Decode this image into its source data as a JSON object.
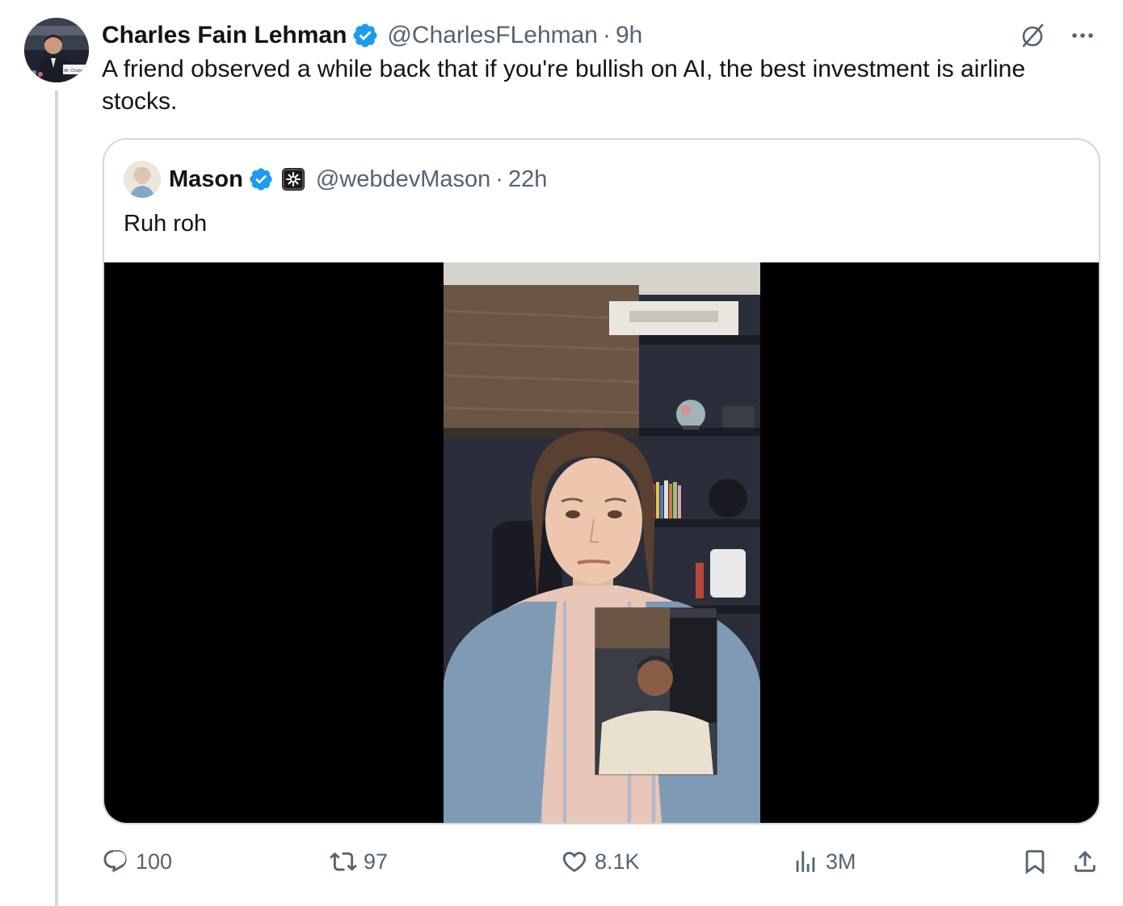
{
  "author": {
    "name": "Charles Fain Lehman",
    "handle": "@CharlesFLehman",
    "separator": "·",
    "time": "9h",
    "avatar_caption": "Mr. Charles"
  },
  "tweet": {
    "text": "A friend observed a while back that if you're bullish on AI, the best investment is airline stocks."
  },
  "quote": {
    "name": "Mason",
    "handle": "@webdevMason",
    "separator": "·",
    "time": "22h",
    "text": "Ruh roh"
  },
  "actions": {
    "replies": "100",
    "reposts": "97",
    "likes": "8.1K",
    "views": "3M"
  },
  "icons": {
    "verified": "verified-badge-icon",
    "grok": "grok-icon",
    "more": "more-icon",
    "reply": "reply-icon",
    "repost": "repost-icon",
    "like": "heart-icon",
    "views": "views-icon",
    "bookmark": "bookmark-icon",
    "share": "share-icon"
  },
  "colors": {
    "verified": "#1d9bf0",
    "secondary_text": "#536471",
    "border": "#cfd9de"
  }
}
